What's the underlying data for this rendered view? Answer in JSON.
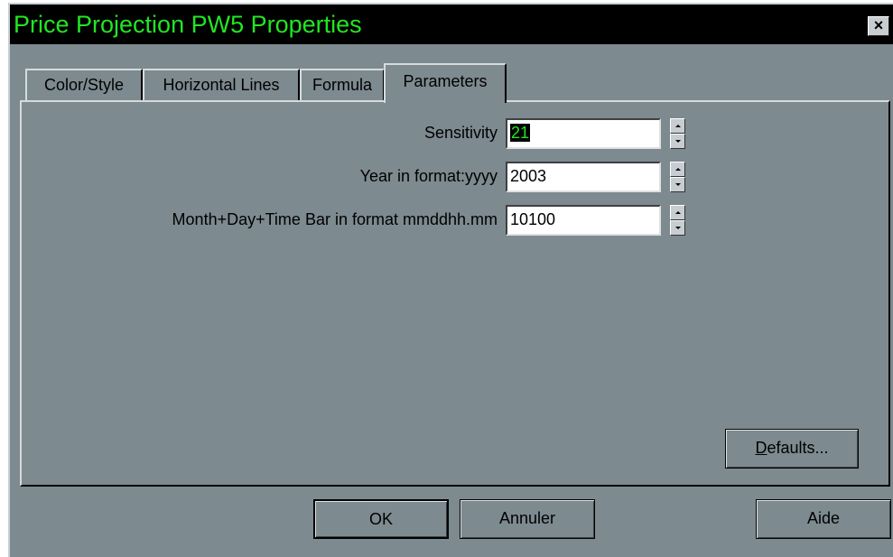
{
  "window": {
    "title": "Price Projection PW5 Properties",
    "close_label": "×"
  },
  "tabs": [
    {
      "label": "Color/Style",
      "active": false
    },
    {
      "label": "Horizontal Lines",
      "active": false
    },
    {
      "label": "Formula",
      "active": false
    },
    {
      "label": "Parameters",
      "active": true
    }
  ],
  "params": {
    "sensitivity": {
      "label": "Sensitivity",
      "value": "21"
    },
    "year": {
      "label": "Year in format:yyyy",
      "value": "2003"
    },
    "month": {
      "label": "Month+Day+Time Bar in format mmddhh.mm",
      "value": "10100"
    }
  },
  "buttons": {
    "defaults_first": "D",
    "defaults_rest": "efaults...",
    "ok": "OK",
    "cancel": "Annuler",
    "help": "Aide"
  },
  "colors": {
    "title_text": "#22e622",
    "dialog_face": "#7d8a90"
  }
}
